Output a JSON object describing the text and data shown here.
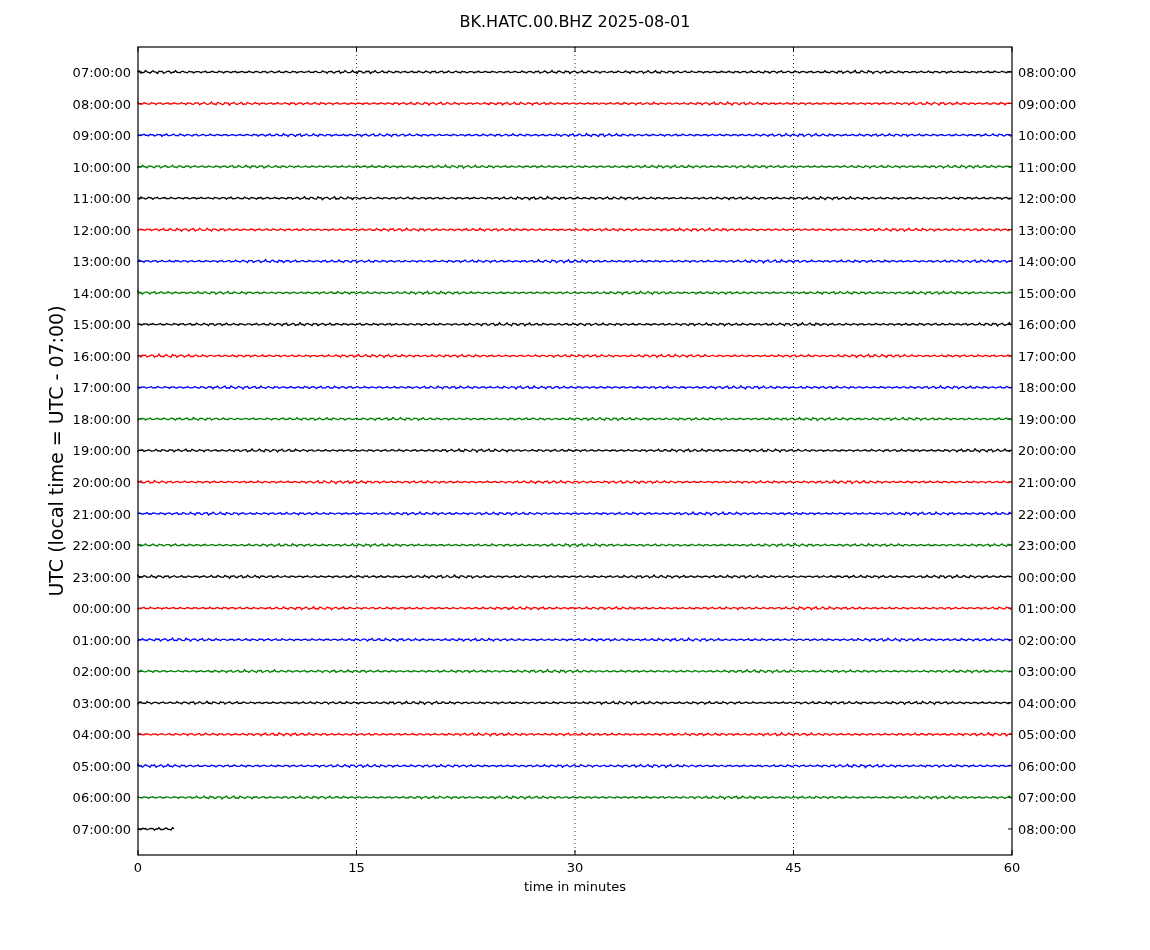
{
  "title": "BK.HATC.00.BHZ 2025-08-01",
  "ylabel": "UTC (local time = UTC - 07:00)",
  "xlabel": "time in minutes",
  "xticks": [
    "0",
    "15",
    "30",
    "45",
    "60"
  ],
  "rows": [
    {
      "left": "07:00:00",
      "right": "08:00:00",
      "color": "#000000",
      "kind": "full"
    },
    {
      "left": "08:00:00",
      "right": "09:00:00",
      "color": "#ff0000",
      "kind": "full"
    },
    {
      "left": "09:00:00",
      "right": "10:00:00",
      "color": "#0000ff",
      "kind": "full"
    },
    {
      "left": "10:00:00",
      "right": "11:00:00",
      "color": "#008000",
      "kind": "full"
    },
    {
      "left": "11:00:00",
      "right": "12:00:00",
      "color": "#000000",
      "kind": "full"
    },
    {
      "left": "12:00:00",
      "right": "13:00:00",
      "color": "#ff0000",
      "kind": "full"
    },
    {
      "left": "13:00:00",
      "right": "14:00:00",
      "color": "#0000ff",
      "kind": "full"
    },
    {
      "left": "14:00:00",
      "right": "15:00:00",
      "color": "#008000",
      "kind": "full"
    },
    {
      "left": "15:00:00",
      "right": "16:00:00",
      "color": "#000000",
      "kind": "full"
    },
    {
      "left": "16:00:00",
      "right": "17:00:00",
      "color": "#ff0000",
      "kind": "full"
    },
    {
      "left": "17:00:00",
      "right": "18:00:00",
      "color": "#0000ff",
      "kind": "full"
    },
    {
      "left": "18:00:00",
      "right": "19:00:00",
      "color": "#008000",
      "kind": "full"
    },
    {
      "left": "19:00:00",
      "right": "20:00:00",
      "color": "#000000",
      "kind": "full"
    },
    {
      "left": "20:00:00",
      "right": "21:00:00",
      "color": "#ff0000",
      "kind": "full"
    },
    {
      "left": "21:00:00",
      "right": "22:00:00",
      "color": "#0000ff",
      "kind": "full"
    },
    {
      "left": "22:00:00",
      "right": "23:00:00",
      "color": "#008000",
      "kind": "full"
    },
    {
      "left": "23:00:00",
      "right": "00:00:00",
      "color": "#000000",
      "kind": "full"
    },
    {
      "left": "00:00:00",
      "right": "01:00:00",
      "color": "#ff0000",
      "kind": "full"
    },
    {
      "left": "01:00:00",
      "right": "02:00:00",
      "color": "#0000ff",
      "kind": "full"
    },
    {
      "left": "02:00:00",
      "right": "03:00:00",
      "color": "#008000",
      "kind": "full"
    },
    {
      "left": "03:00:00",
      "right": "04:00:00",
      "color": "#000000",
      "kind": "full"
    },
    {
      "left": "04:00:00",
      "right": "05:00:00",
      "color": "#ff0000",
      "kind": "full"
    },
    {
      "left": "05:00:00",
      "right": "06:00:00",
      "color": "#0000ff",
      "kind": "full"
    },
    {
      "left": "06:00:00",
      "right": "07:00:00",
      "color": "#008000",
      "kind": "full"
    },
    {
      "left": "07:00:00",
      "right": "08:00:00",
      "color": "#000000",
      "kind": "partial"
    }
  ]
}
